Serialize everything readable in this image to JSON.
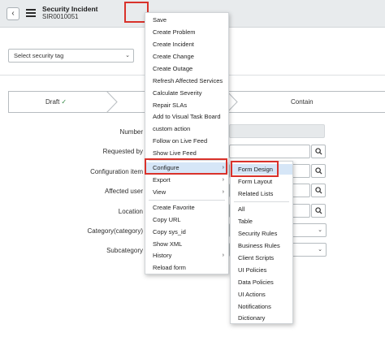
{
  "header": {
    "title": "Security Incident",
    "number": "SIR0010051",
    "back_icon": "‹"
  },
  "security_tag": {
    "placeholder": "Select security tag",
    "chevron": "⌄"
  },
  "process_flow": {
    "stages": [
      "Draft",
      "Contain"
    ],
    "draft_check": "✓"
  },
  "form": {
    "labels": {
      "number": "Number",
      "requested_by": "Requested by",
      "configuration_item": "Configuration item",
      "affected_user": "Affected user",
      "location": "Location",
      "category": "Category(category)",
      "subcategory": "Subcategory"
    },
    "chevron": "⌄"
  },
  "context_menu": {
    "items": [
      "Save",
      "Create Problem",
      "Create Incident",
      "Create Change",
      "Create Outage",
      "Refresh Affected Services",
      "Calculate Severity",
      "Repair SLAs",
      "Add to Visual Task Board",
      "custom action",
      "Follow on Live Feed",
      "Show Live Feed",
      "Configure",
      "Export",
      "View",
      "Create Favorite",
      "Copy URL",
      "Copy sys_id",
      "Show XML",
      "History",
      "Reload form"
    ],
    "active": "Configure",
    "arrow": "›"
  },
  "configure_submenu": {
    "items": [
      "Form Design",
      "Form Layout",
      "Related Lists",
      "All",
      "Table",
      "Security Rules",
      "Business Rules",
      "Client Scripts",
      "UI Policies",
      "Data Policies",
      "UI Actions",
      "Notifications",
      "Dictionary"
    ],
    "active": "Form Design"
  },
  "colors": {
    "highlight": "#d9322b",
    "active_row": "#d6e6f7",
    "header_bg": "#e8ebed",
    "check": "#2e8540"
  }
}
